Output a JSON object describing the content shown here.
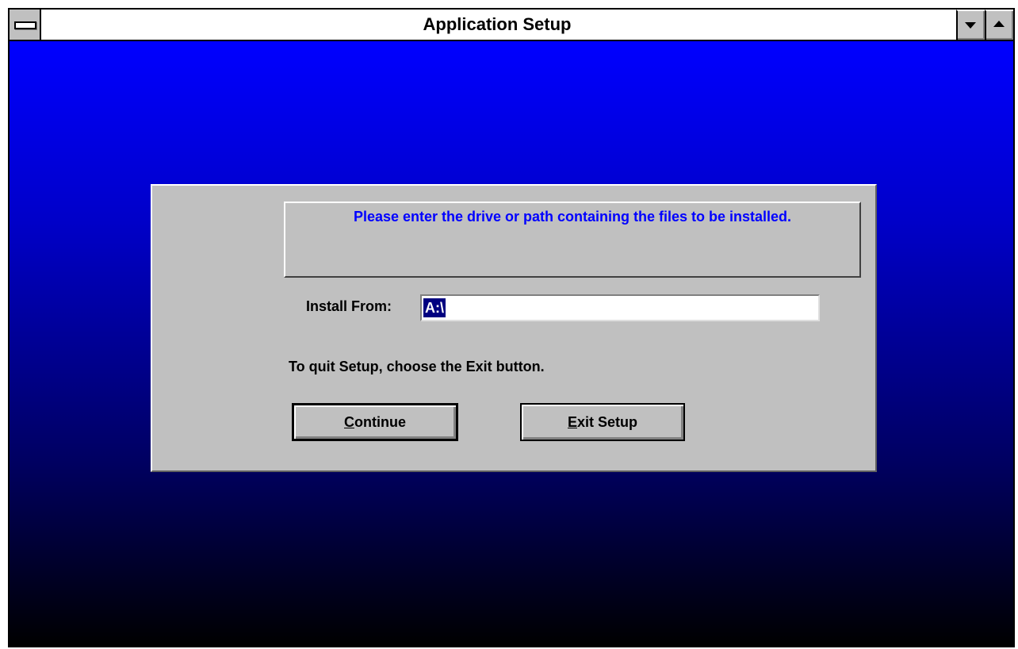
{
  "window": {
    "title": "Application Setup"
  },
  "dialog": {
    "message": "Please enter the drive or path containing the files to be installed.",
    "install_from_label": "Install From:",
    "install_from_value": "A:\\",
    "quit_hint": "To quit Setup, choose the Exit button.",
    "continue_button": {
      "mnemonic": "C",
      "rest": "ontinue"
    },
    "exit_button": {
      "mnemonic": "E",
      "rest": "xit Setup"
    }
  },
  "colors": {
    "background_top": "#0000ff",
    "background_bottom": "#000000",
    "dialog_face": "#c0c0c0",
    "message_text": "#0000ff",
    "selection": "#000080"
  },
  "icons": {
    "system_menu": "system-menu-icon",
    "minimize": "minimize-arrow-icon",
    "maximize": "maximize-arrow-icon"
  }
}
